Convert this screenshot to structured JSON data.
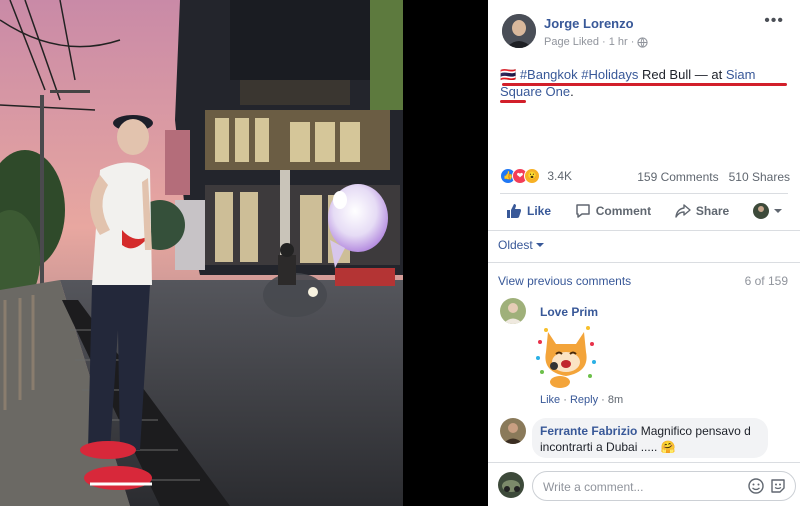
{
  "post": {
    "author": "Jorge Lorenzo",
    "page_status": "Page Liked",
    "time": "1 hr",
    "flag": "🇹🇭",
    "hashtags": "#Bangkok #Holidays",
    "text_plain": "Red Bull",
    "location_prefix": "— at",
    "location": "Siam Square One",
    "punct": "."
  },
  "stats": {
    "reactions_count": "3.4K",
    "comments": "159 Comments",
    "shares": "510 Shares"
  },
  "actions": {
    "like": "Like",
    "comment": "Comment",
    "share": "Share"
  },
  "sort": {
    "label": "Oldest"
  },
  "comments_nav": {
    "view_previous": "View previous comments",
    "count": "6 of 159"
  },
  "comments": [
    {
      "name": "Love Prim",
      "like": "Like",
      "reply": "Reply",
      "time": "8m"
    },
    {
      "name": "Ferrante Fabrizio",
      "text": "Magnifico pensavo d incontrarti a Dubai .....",
      "emoji": "🤗"
    }
  ],
  "composer": {
    "placeholder": "Write a comment..."
  },
  "icons": [
    "more-icon",
    "globe-icon",
    "like-reaction-icon",
    "love-reaction-icon",
    "wow-reaction-icon",
    "thumbs-up-icon",
    "comment-icon",
    "share-icon",
    "chevron-down-icon",
    "emoji-icon",
    "sticker-icon"
  ],
  "colors": {
    "link": "#385898",
    "underline": "#d21f2a",
    "like_blue": "#2078f4"
  }
}
